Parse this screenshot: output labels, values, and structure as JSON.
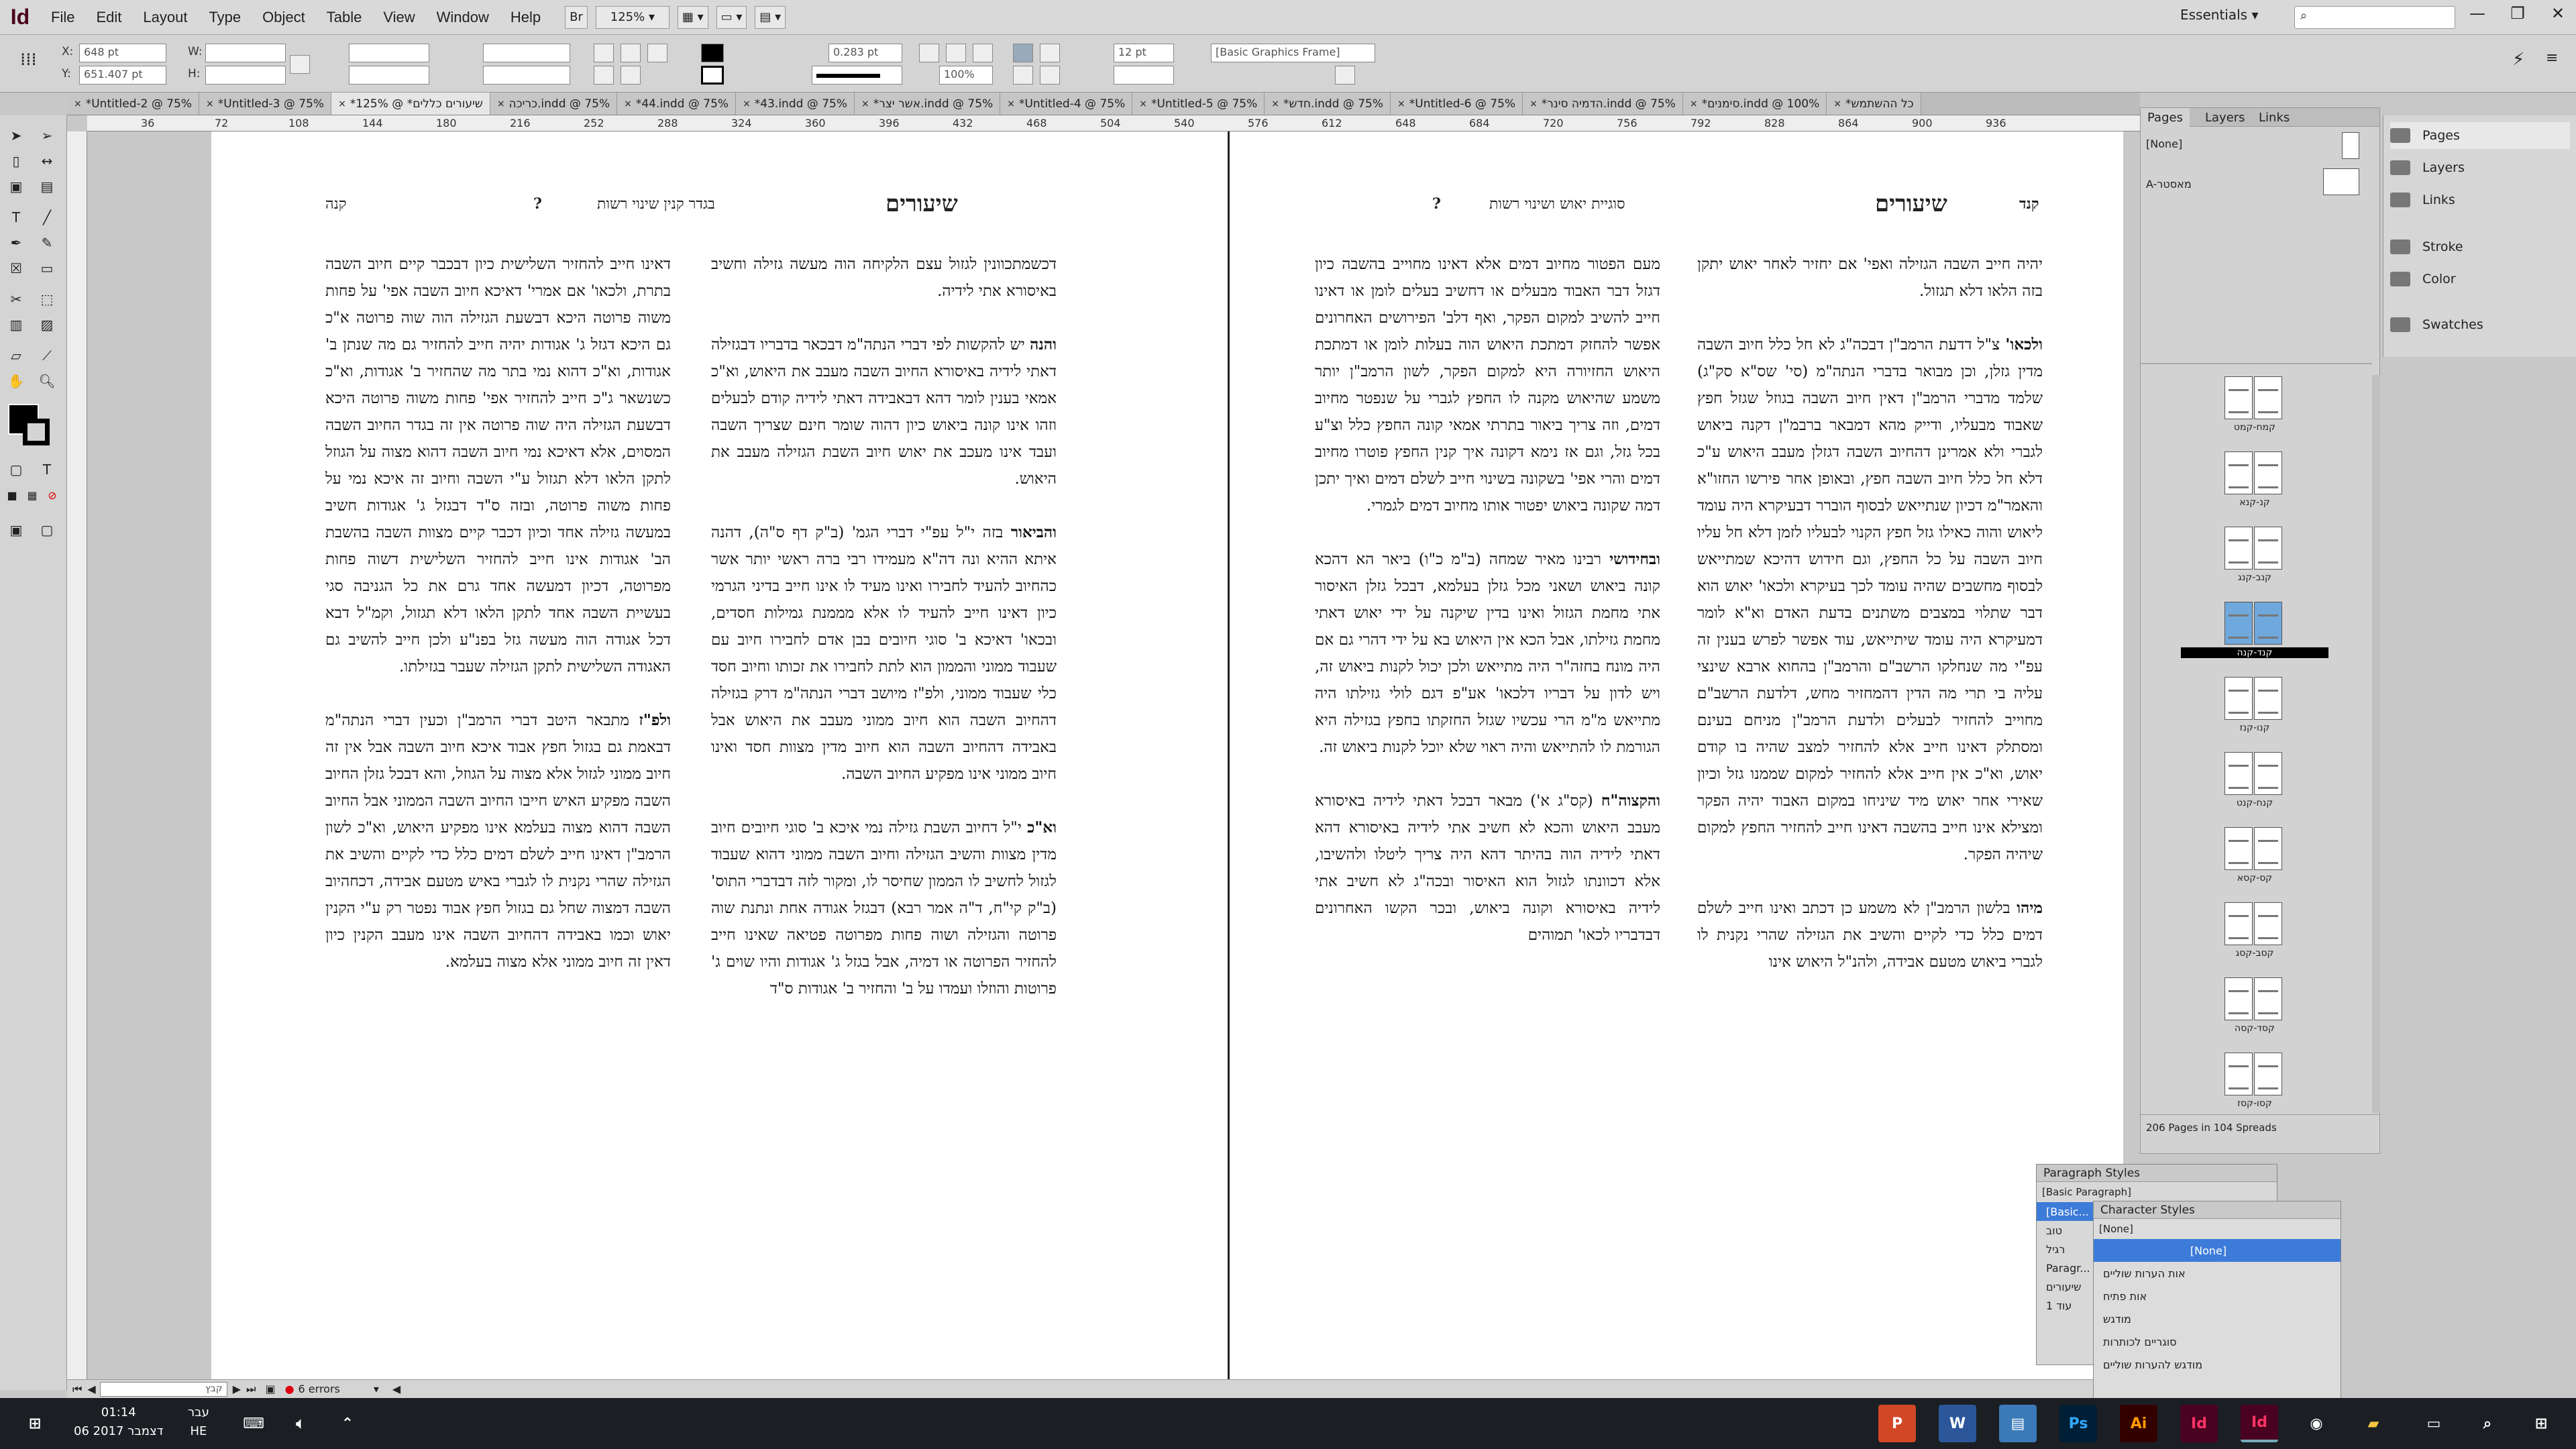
{
  "app": {
    "logo": "Id",
    "zoom": "125%",
    "workspace": "Essentials",
    "search_placeholder": ""
  },
  "menu": [
    "File",
    "Edit",
    "Layout",
    "Type",
    "Object",
    "Table",
    "View",
    "Window",
    "Help"
  ],
  "control": {
    "x": "648 pt",
    "y": "651.407 pt",
    "stroke_weight": "0.283 pt",
    "percent": "100%",
    "size": "12 pt",
    "object_style": "[Basic Graphics Frame]"
  },
  "tabs": [
    "*Untitled-2 @ 75%",
    "*Untitled-3 @ 75%",
    "*שיעורים כללים* @ 125%",
    "כריכה.indd @ 75%",
    "*44.indd @ 75%",
    "*43.indd @ 75%",
    "*אשר יצר.indd @ 75%",
    "*Untitled-4 @ 75%",
    "*Untitled-5 @ 75%",
    "*חדש.indd @ 75%",
    "*Untitled-6 @ 75%",
    "*הדמיה סינר.indd @ 75%",
    "*סימנים.indd @ 100%",
    "*כל ההשתמש"
  ],
  "ruler": [
    "36",
    "72",
    "108",
    "144",
    "180",
    "216",
    "252",
    "288",
    "324",
    "360",
    "396",
    "432",
    "468",
    "504",
    "540",
    "576",
    "612",
    "648",
    "684",
    "720",
    "756",
    "792",
    "828",
    "864",
    "900",
    "936"
  ],
  "page_headers": {
    "left_title": "שיעורים",
    "left_mid": "בגדר קנין שינוי רשות",
    "left_q": "?",
    "left_right": "קנה",
    "right_title": "שיעורים",
    "right_mid": "סוגיית יאוש ושינוי רשות",
    "right_q": "?",
    "right_right": "קנד"
  },
  "columns": {
    "c1": [
      "דאינו חייב להחזיר השלישית כיון דבכבר קיים חיוב השבה בתרת, ולכאו' אם אמרי' דאיכא חיוב השבה אפי' על פחות משוה פרוטה היכא דבשעת הגזילה הוה שוה פרוטה א\"כ גם היכא דגזל ג' אגודות יהיה חייב להחזיר גם מה שנתן ב' אגודות, וא\"כ דהוא נמי בתר מה שהחזיר ב' אגודות, וא\"כ כשנשאר ג\"כ חייב להחזיר אפי' פחות משוה פרוטה היכא דבשעת הגזילה היה שוה פרוטה אין זה בגדר החיוב השבה המסוים, אלא דאיכא נמי חיוב השבה דהוא מצוה על הגוזל לתקן הלאו דלא תגזול ע\"י השבה וחיוב זה איכא נמי על פחות משוה פרוטה, ובזה ס\"ד דבגזל ג' אגודות חשיב במעשה גזילה אחד וכיון דכבר קיים מצוות השבה בהשבת הב' אגודות אינו חייב להחזיר השלישית דשוה פחות מפרוטה, דכיון דמעשה אחד גרם את כל הגניבה סגי בעשיית השבה אחד לתקן הלאו דלא תגזול, וקמ\"ל דבא דכל אגודה הוה מעשה גזל בפנ\"ע ולכן חייב להשיב גם האגודה השלישית לתקן הגזילה שעבר בגזילתו.",
      "<b>ולפ\"ז</b> מתבאר היטב דברי הרמב\"ן וכעין דברי הנתה\"מ דבאמת גם בגזול חפץ אבוד איכא חיוב השבה אבל אין זה חיוב ממוני לגזול אלא מצוה על הגוזל, והא דבכל גזלן החיוב השבה מפקיע האיש חייבו החיוב השבה הממוני אבל החיוב השבה דהוא מצוה בעלמא אינו מפקיע היאוש, וא\"כ לשון הרמב\"ן דאינו חייב לשלם דמים כלל כדי לקיים והשיב את הגזילה שהרי נקנית לו לגברי באיש מטעם אבידה, דכחהיוב השבה דמצוה שחל גם בגזול חפץ אבוד נפטר רק ע\"י הקנין יאוש וכמו באבידה דהחיוב השבה אינו מעבב הקנין כיון דאין זה חיוב ממוני אלא מצוה בעלמא."
    ],
    "c2": [
      "דכשמתכוונין לגזול עצם הלקיחה הוה מעשה גזילה וחשיב באיסורא אתי לידיה.",
      "<b>והנה</b> יש להקשות לפי דברי הנתה\"מ דבכאר בדבריו דבגזילה דאתי לידיה באיסורא החיוב השבה מעבב את היאוש, וא\"כ אמאי בענין לומר דהא דבאבידה דאתי לידיה קודם לבעלים וזהו אינו קונה ביאוש כיון דהוה שומר חינם שצריך השבה ועבד אינו מעכב את יאוש חיוב השבת הגזילה מעבב את היאוש.",
      "<b>והביאור</b> בזה י\"ל עפ\"י דברי הגמ' (ב\"ק דף ס\"ה), דהנה איתא ההיא ונה דה\"א מעמידו רבי ברה ראשי יותר אשר כהחיוב להעיד לחבירו ואינו מעיד לו אינו חייב בדיני הגרמי כיון דאינו חייב להעיד לו אלא מממנת גמילות חסדים, ובכאו' דאיכא ב' סוגי חיובים בבן אדם לחבירו חיוב עם שעבוד ממוני והממון הוא לתת לחבירו את זכותו וחיוב חסד כלי שעבוד ממוני, ולפ\"ז מיושב דברי הנתה\"מ דרק בגזילה דהחיוב השבה הוא חיוב ממוני מעבב את היאוש אבל באבידה דהחיוב השבה הוא חיוב מדין מצוות חסד ואינו חיוב ממוני אינו מפקיע החיוב השבה.",
      "<b>וא\"כ</b> י\"ל דחיוב השבת גזילה נמי איכא ב' סוגי חיובים חיוב מדין מצוות והשיב הגזילה וחיוב השבה ממוני דהוא שעבוד לגזול לחשיב לו הממון שחיסר לו, ומקור לזה דבדברי התוס' (ב\"ק קי\"ח, ד\"ה אמר רבא) דבגזל אגודה אחת ונתנת שוה פרוטה והגזילה ושוה פחות מפרוטה פטיאה שאינו חייב להחזיר הפרוטה או דמיה, אבל בגזל ג' אגודות והיו שוים ג' פרוטות והוזלו ועמדו על ב' והחזיר ב' אגודות ס\"ד"
    ],
    "c3": [
      "מעם הפטור מחיוב דמים אלא דאינו מחוייב בהשבה כיון דגזל דבר האבוד מבעלים או דחשיב בעלים לומן או דאינו חייב להשיב למקום הפקר, ואף דלב' הפירושים האחרונים אפשר להחזק דמתכת היאוש הוה בעלות לומן או דמתכת היאוש החזיורה היא למקום הפקר, לשון הרמב\"ן יותר משמע שהיאוש מקנה לו החפץ לגברי על שנפטר מחיוב דמים, וזה צריך ביאור בתרתי אמאי קונה החפץ כלל וצ\"ע בכל גזל, וגם אז נימא דקונה איך קנין החפץ פוטרו מחיוב דמים והרי אפי' בשקונה בשינוי חייב לשלם דמים ואיך יתכן דמה שקונה ביאוש יפטור אותו מחיוב דמים לגמרי.",
      "<b>ובחידושי</b> רבינו מאיר שמחה (ב\"מ כ\"ו) ביאר הא דהכא קונה ביאוש ושאני מכל גזלן בעלמא, דבכל גזלן האיסור אתי מחמת הגזול ואינו בדין שיקנה על ידי יאוש דאתי מחמת גזילתו, אבל הכא אין היאוש בא על ידי דהרי גם אם היה מונח בחזה\"ר היה מתייאש ולכן יכול לקנות ביאוש זה, ויש לדון על דבריו דלכאו' אע\"פ דגם לולי גזילתו היה מתייאש מ\"מ הרי עכשיו שגזל החזקתו בחפץ בגזילה היא הגורמת לו להתייאש והיה ראוי שלא יוכל לקנות ביאוש זה.",
      "<b>והקצוה\"ח</b> (קס\"ג א') מבאר דבכל דאתי לידיה באיסורא מעבב היאוש והכא לא חשיב אתי לידיה באיסורא דהא דאתי לידיה הוה בהיתר דהא היה צריך ליטלו ולהשיבו, אלא דכוונתו לגזול הוא האיסור ובכה\"ג לא חשיב אתי לידיה באיסורא וקונה ביאוש, ובכר הקשו האחרונים דבדבריו לכאו' תמוהים"
    ],
    "c4": [
      "יהיה חייב השבה הגזילה ואפי' אם יחזיר לאחר יאוש יתקן בזה הלאו דלא תגזול.",
      "<b>ולכאו'</b> צ\"ל דדעת הרמב\"ן דבכה\"ג לא חל כלל חיוב השבה מדין גזלן, וכן מבואר בדברי הנתה\"מ (סי' שס\"א סק\"ג) שלמד מדברי הרמב\"ן דאין חיוב השבה בגוזל שגזל חפץ שאבוד מבעליו, ודייק מהא דמבאר ברבמ\"ן דקנה ביאוש לגברי ולא אמרינן דהחיוב השבה דגזלן מעבב היאוש ע\"כ דלא חל כלל חיוב השבה חפץ, ובאופן אחר פירשו החזו\"א והאמר\"מ דכיון שנתייאש לבסוף הוברר דבעיקרא היה עומד ליאוש והוה כאילו גזל חפץ הקנוי לבעליו לזמן דלא חל עליו חיוב השבה על כל החפץ, וגם חידוש דהיכא שמתייאש לבסוף מחשבים שהיה עומד לכך בעיקרא ולכאו' יאוש הוא דבר שתלוי במצבים משתנים בדעת האדם וא\"א לומר דמעיקרא היה עומד שיתייאש, עוד אפשר לפרש בענין זה עפ\"י מה שנחלקו הרשב\"ם והרמב\"ן בהחוא ארבא שינצי עליה בי תרי מה הדין דהמחזיר מחש, דלדעת הרשב\"ם מחוייב להחזיר לבעלים ולדעת הרמב\"ן מניחם בעינם ומסתלק דאינו חייב אלא להחזיר למצב שהיה בו קודם יאוש, וא\"כ אין חייב אלא להחזיר למקום שממנו גזל וכיון שאירי אחר יאוש מיד שיניחו במקום האבוד יהיה הפקר ומצילא אינו חייב בהשבה דאינו חייב להחזיר החפץ למקום שיהיה הפקר.",
      "<b>מיהו</b> בלשון הרמב\"ן לא משמע כן דכתב ואינו חייב לשלם דמים כלל כדי לקיים והשיב את הגזילה שהרי נקנית לו לגברי ביאוש מטעם אבידה, ולהנ\"ל היאוש אינו"
    ]
  },
  "status": {
    "page": "קבץ",
    "errors": "6 errors"
  },
  "pages_panel": {
    "tabs": [
      "Pages",
      "Layers",
      "Links"
    ],
    "masters": [
      "[None]",
      "A-מאסטר"
    ],
    "thumbs": [
      "קמח-קמט",
      "קנ-קנא",
      "קנב-קנג",
      "קנד-קנה",
      "קנו-קנז",
      "קנח-קנט",
      "קס-קסא",
      "קסב-קסג",
      "קסד-קסה",
      "קסו-קסז"
    ],
    "selected_index": 3,
    "footer": "206 Pages in 104 Spreads"
  },
  "right_panel": [
    "Pages",
    "Layers",
    "Links",
    "Stroke",
    "Color",
    "Swatches"
  ],
  "para_panel": {
    "title": "Paragraph Styles",
    "current": "[Basic Paragraph]",
    "rows": [
      "[Basic...",
      "טוב",
      "רגיל",
      "Paragr...",
      "שיעורים",
      "עוד 1"
    ]
  },
  "char_panel": {
    "title": "Character Styles",
    "current": "[None]",
    "rows": [
      "[None]",
      "אות הערות שוליים",
      "אות פתיח",
      "מודגש",
      "סוגריים לכותרות",
      "מודגש להערות שוליים"
    ],
    "selected_index": 0
  },
  "taskbar": {
    "time": "01:14",
    "date": "06 דצמבר 2017",
    "lang": "עבר",
    "lang2": "HE"
  }
}
